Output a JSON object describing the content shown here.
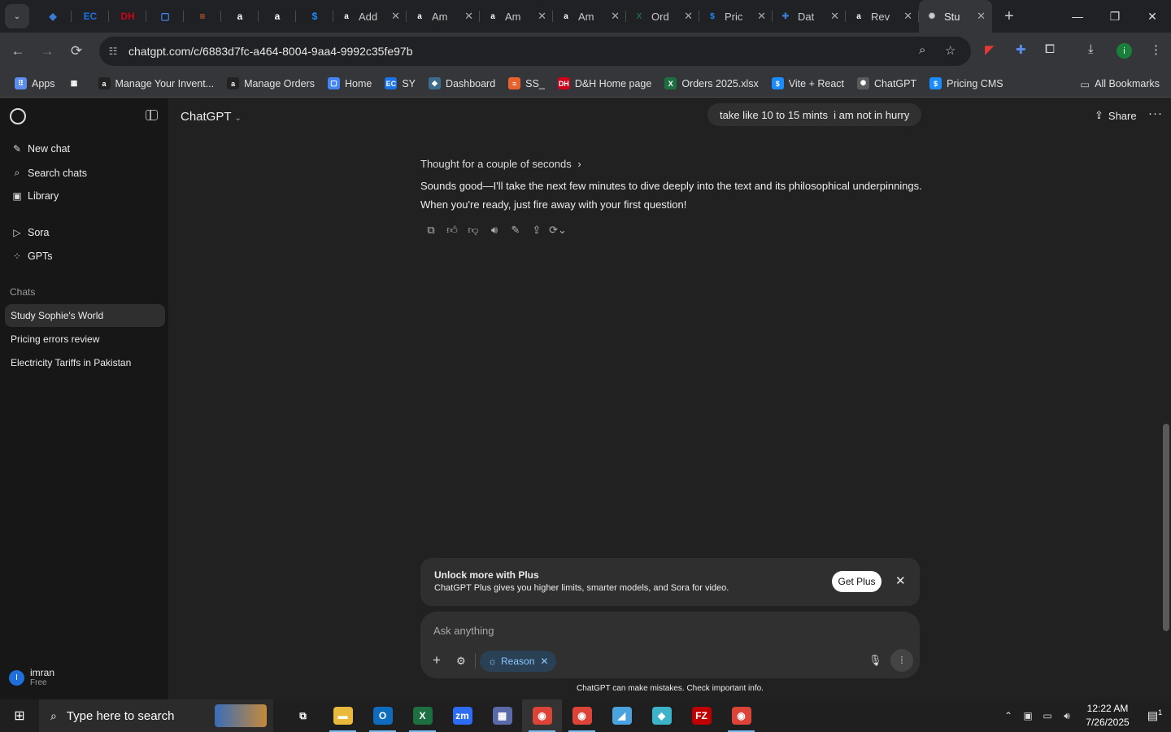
{
  "browser": {
    "pinned_tabs": [
      {
        "icon": "blue-diamond-icon",
        "color": "#3a7bd5",
        "glyph": "◆"
      },
      {
        "icon": "ec-icon",
        "color": "#1a73e8",
        "glyph": "EC"
      },
      {
        "icon": "dh-icon",
        "color": "#d0021b",
        "glyph": "DH"
      },
      {
        "icon": "docs-icon",
        "color": "#4285f4",
        "glyph": "▢"
      },
      {
        "icon": "stack-icon",
        "color": "#e8632c",
        "glyph": "≡"
      },
      {
        "icon": "amazon-icon",
        "color": "#ffffff",
        "glyph": "a"
      },
      {
        "icon": "amazon-icon",
        "color": "#ffffff",
        "glyph": "a"
      },
      {
        "icon": "dollar-icon",
        "color": "#1a8cff",
        "glyph": "$"
      }
    ],
    "tabs": [
      {
        "title": "Add",
        "icon": "amazon-icon",
        "glyph": "a",
        "color": "#ffffff"
      },
      {
        "title": "Am",
        "icon": "amazon-icon",
        "glyph": "a",
        "color": "#ffffff"
      },
      {
        "title": "Am",
        "icon": "amazon-icon",
        "glyph": "a",
        "color": "#ffffff"
      },
      {
        "title": "Am",
        "icon": "amazon-icon",
        "glyph": "a",
        "color": "#ffffff"
      },
      {
        "title": "Ord",
        "icon": "excel-icon",
        "glyph": "X",
        "color": "#1d6f42"
      },
      {
        "title": "Pric",
        "icon": "dollar-icon",
        "glyph": "$",
        "color": "#1a8cff"
      },
      {
        "title": "Dat",
        "icon": "blue-app-icon",
        "glyph": "✚",
        "color": "#3a7bd5"
      },
      {
        "title": "Rev",
        "icon": "amazon-icon",
        "glyph": "a",
        "color": "#ffffff"
      },
      {
        "title": "Stu",
        "icon": "openai-icon",
        "glyph": "✺",
        "color": "#cccccc",
        "active": true
      }
    ],
    "url": "chatgpt.com/c/6883d7fc-a464-8004-9aa4-9992c35fe97b",
    "bookmarks": [
      {
        "label": "Apps",
        "icon": "apps-grid-icon",
        "color": "#5b8def",
        "glyph": "⠿"
      },
      {
        "label": "",
        "icon": "tab-groups-icon",
        "color": "#35363a",
        "glyph": "▦"
      },
      {
        "label": "Manage Your Invent...",
        "icon": "amazon-icon",
        "color": "#222222",
        "glyph": "a"
      },
      {
        "label": "Manage Orders",
        "icon": "amazon-icon",
        "color": "#222222",
        "glyph": "a"
      },
      {
        "label": "Home",
        "icon": "docs-icon",
        "color": "#4285f4",
        "glyph": "▢"
      },
      {
        "label": "SY",
        "icon": "ec-icon",
        "color": "#1a73e8",
        "glyph": "EC"
      },
      {
        "label": "Dashboard",
        "icon": "diamond-icon",
        "color": "#3d6b8c",
        "glyph": "◆"
      },
      {
        "label": "SS_",
        "icon": "stack-icon",
        "color": "#e8632c",
        "glyph": "≡"
      },
      {
        "label": "D&H Home page",
        "icon": "dh-icon",
        "color": "#d0021b",
        "glyph": "DH"
      },
      {
        "label": "Orders 2025.xlsx",
        "icon": "excel-icon",
        "color": "#1d6f42",
        "glyph": "X"
      },
      {
        "label": "Vite + React",
        "icon": "dollar-icon",
        "color": "#1a8cff",
        "glyph": "$"
      },
      {
        "label": "ChatGPT",
        "icon": "openai-icon",
        "color": "#5a5a5a",
        "glyph": "✺"
      },
      {
        "label": "Pricing CMS",
        "icon": "dollar-icon",
        "color": "#1a8cff",
        "glyph": "$"
      }
    ],
    "all_bookmarks": "All Bookmarks"
  },
  "sidebar": {
    "items": [
      {
        "label": "New chat",
        "icon": "new-chat-icon",
        "glyph": "✎"
      },
      {
        "label": "Search chats",
        "icon": "search-icon",
        "glyph": "⌕"
      },
      {
        "label": "Library",
        "icon": "library-icon",
        "glyph": "▣"
      },
      {
        "label": "Sora",
        "icon": "sora-icon",
        "glyph": "▷"
      },
      {
        "label": "GPTs",
        "icon": "gpts-icon",
        "glyph": "⁘"
      }
    ],
    "chats_heading": "Chats",
    "chats": [
      {
        "title": "Study Sophie's World",
        "active": true
      },
      {
        "title": "Pricing errors review"
      },
      {
        "title": "Electricity Tariffs in Pakistan"
      }
    ],
    "user": {
      "initial": "I",
      "name": "imran",
      "plan": "Free"
    }
  },
  "main": {
    "model": "ChatGPT",
    "user_message": "take like 10 to 15 mints  i am not in hurry",
    "share": "Share",
    "thought": "Thought for a couple of seconds",
    "answer": "Sounds good—I'll take the next few minutes to dive deeply into the text and its philosophical underpinnings. When you're ready, just fire away with your first question!",
    "actions": [
      {
        "name": "copy-icon",
        "glyph": "⧉"
      },
      {
        "name": "thumbs-up-icon",
        "glyph": "👍︎"
      },
      {
        "name": "thumbs-down-icon",
        "glyph": "👎︎"
      },
      {
        "name": "read-aloud-icon",
        "glyph": "🔊︎"
      },
      {
        "name": "edit-canvas-icon",
        "glyph": "✎"
      },
      {
        "name": "share-icon",
        "glyph": "⇪"
      },
      {
        "name": "regenerate-icon",
        "glyph": "⟳⌄"
      }
    ],
    "promo": {
      "title": "Unlock more with Plus",
      "subtitle": "ChatGPT Plus gives you higher limits, smarter models, and Sora for video.",
      "button": "Get Plus"
    },
    "composer": {
      "placeholder": "Ask anything",
      "reason": "Reason"
    },
    "disclaimer": "ChatGPT can make mistakes. Check important info."
  },
  "taskbar": {
    "search_placeholder": "Type here to search",
    "apps": [
      {
        "name": "task-view-icon",
        "glyph": "⧉",
        "color": "#1f1f1f"
      },
      {
        "name": "file-explorer-icon",
        "glyph": "▬",
        "color": "#e8b93a",
        "running": true
      },
      {
        "name": "outlook-icon",
        "glyph": "O",
        "color": "#0f6cbd",
        "running": true
      },
      {
        "name": "excel-icon",
        "glyph": "X",
        "color": "#1d6f42",
        "running": true
      },
      {
        "name": "zoom-icon",
        "glyph": "zm",
        "color": "#2d6cf6"
      },
      {
        "name": "calculator-icon",
        "glyph": "▦",
        "color": "#5a6aa8"
      },
      {
        "name": "chrome-icon",
        "glyph": "◉",
        "color": "#db4437",
        "running": true,
        "active": true
      },
      {
        "name": "chrome-icon",
        "glyph": "◉",
        "color": "#db4437",
        "running": true
      },
      {
        "name": "notes-app-icon",
        "glyph": "◢",
        "color": "#4aa3df"
      },
      {
        "name": "diamond-app-icon",
        "glyph": "◆",
        "color": "#3db3c9"
      },
      {
        "name": "filezilla-icon",
        "glyph": "FZ",
        "color": "#bf0000"
      },
      {
        "name": "chrome-icon",
        "glyph": "◉",
        "color": "#db4437",
        "running": true
      }
    ],
    "time": "12:22 AM",
    "date": "7/26/2025",
    "notifications": "1"
  }
}
